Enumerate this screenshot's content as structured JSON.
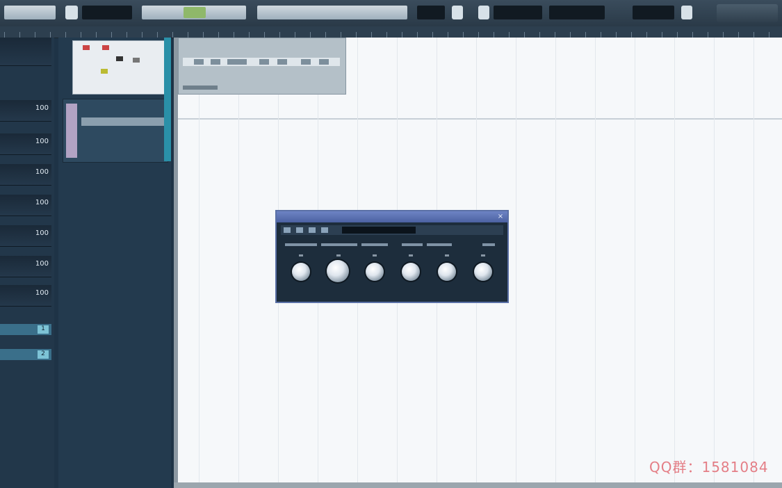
{
  "toolbar": {
    "items": [
      {
        "kind": "light",
        "label": ""
      },
      {
        "kind": "dark",
        "label": ""
      },
      {
        "kind": "light",
        "label": ""
      },
      {
        "kind": "light",
        "label": ""
      },
      {
        "kind": "dark",
        "label": ""
      },
      {
        "kind": "dark",
        "label": ""
      },
      {
        "kind": "dark",
        "label": ""
      }
    ]
  },
  "mixer": {
    "channels": [
      {
        "value": "100"
      },
      {
        "value": "100"
      },
      {
        "value": "100"
      },
      {
        "value": "100"
      },
      {
        "value": "100"
      },
      {
        "value": "100"
      },
      {
        "value": "100"
      }
    ],
    "tags": [
      "1",
      "2"
    ]
  },
  "browser": {
    "channels": [
      "",
      "",
      ""
    ]
  },
  "plugin": {
    "title": "",
    "knob_count": 6
  },
  "contact": {
    "text": "QQ群：1581084"
  },
  "colors": {
    "accent": "#2a90a8",
    "plugin_title": "#5a70a6",
    "watermark": "#e0606a"
  }
}
